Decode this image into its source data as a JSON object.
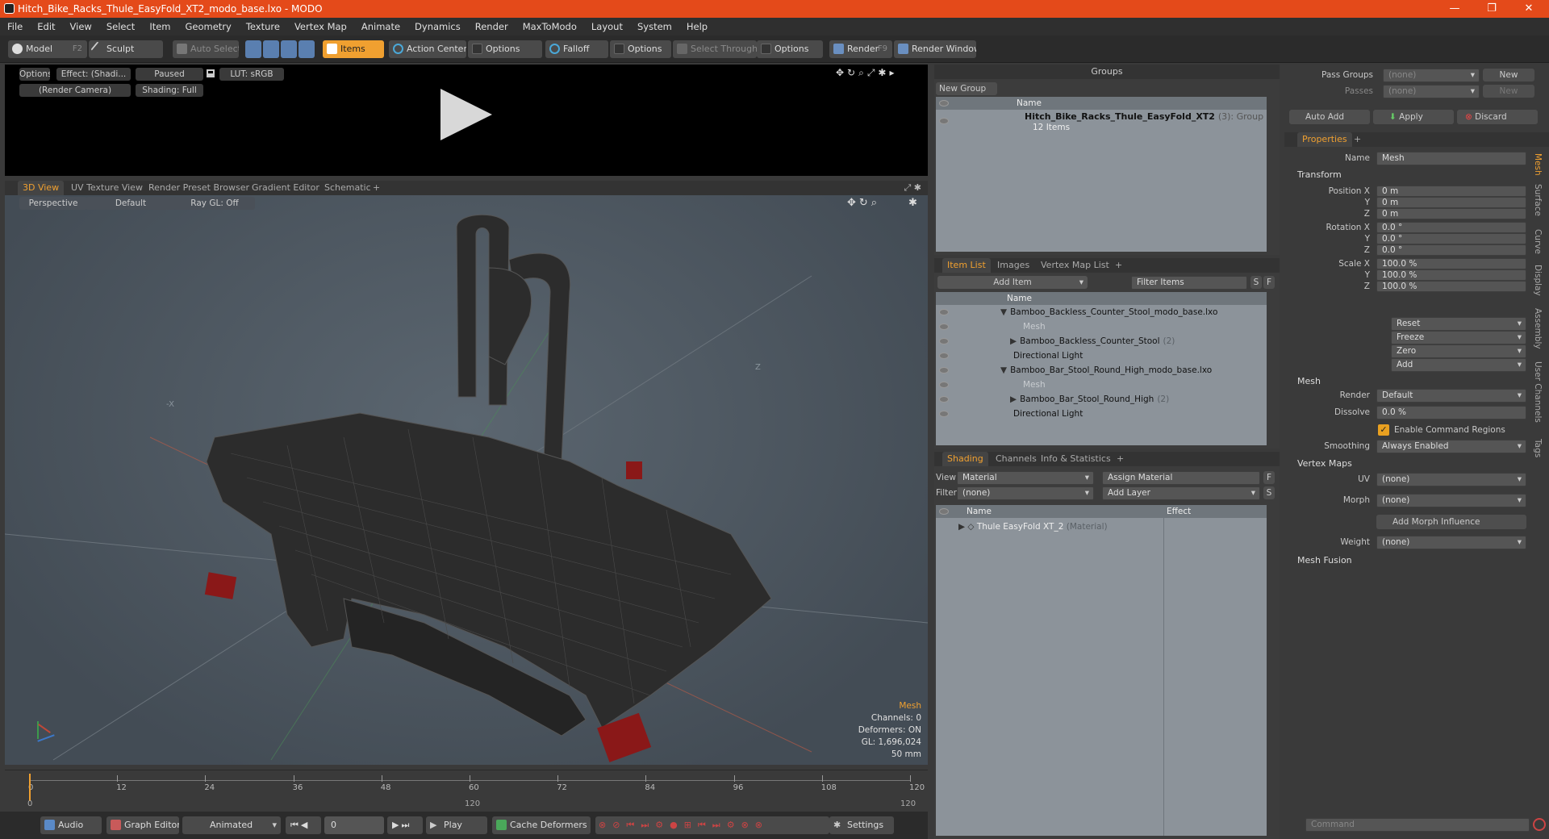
{
  "window": {
    "title": "Hitch_Bike_Racks_Thule_EasyFold_XT2_modo_base.lxo - MODO",
    "min": "—",
    "max": "❐",
    "close": "✕"
  },
  "menu": [
    "File",
    "Edit",
    "View",
    "Select",
    "Item",
    "Geometry",
    "Texture",
    "Vertex Map",
    "Animate",
    "Dynamics",
    "Render",
    "MaxToModo",
    "Layout",
    "System",
    "Help"
  ],
  "toolbar": {
    "model": "Model",
    "model_key": "F2",
    "sculpt": "Sculpt",
    "auto_select": "Auto Select",
    "items": "Items",
    "action_center": "Action Center",
    "options1": "Options",
    "falloff": "Falloff",
    "options2": "Options",
    "select_through": "Select Through",
    "options3": "Options",
    "render": "Render",
    "render_key": "F9",
    "render_window": "Render Window"
  },
  "preview": {
    "options": "Options",
    "effect": "Effect: (Shadi...",
    "paused": "Paused",
    "lut": "LUT: sRGB",
    "camera": "(Render Camera)",
    "shading": "Shading: Full"
  },
  "viewport_tabs": [
    "3D View",
    "UV Texture View",
    "Render Preset Browser",
    "Gradient Editor",
    "Schematic",
    "+"
  ],
  "viewport": {
    "perspective": "Perspective",
    "default": "Default",
    "raygl": "Ray GL: Off",
    "axis_z": "Z",
    "axis_x": "-X",
    "info": {
      "mesh": "Mesh",
      "channels": "Channels: 0",
      "deformers": "Deformers: ON",
      "gl": "GL: 1,696,024",
      "mm": "50 mm"
    }
  },
  "timeline": {
    "ticks": [
      "0",
      "12",
      "24",
      "36",
      "48",
      "60",
      "72",
      "84",
      "96",
      "108",
      "120"
    ],
    "sub_ticks": [
      "0",
      "120",
      "120"
    ]
  },
  "bottombar": {
    "audio": "Audio",
    "graph_editor": "Graph Editor",
    "animated": "Animated",
    "frame": "0",
    "play": "Play",
    "cache": "Cache Deformers",
    "settings": "Settings"
  },
  "groups": {
    "title": "Groups",
    "new_group": "New Group",
    "col_name": "Name",
    "item_name": "Hitch_Bike_Racks_Thule_EasyFold_XT2",
    "item_count": "(3)",
    "item_type": ": Group",
    "item_sub": "12 Items"
  },
  "itemlist": {
    "tabs": [
      "Item List",
      "Images",
      "Vertex Map List",
      "+"
    ],
    "add_item": "Add Item",
    "filter": "Filter Items",
    "s": "S",
    "f": "F",
    "col_name": "Name",
    "rows": [
      {
        "name": "Bamboo_Backless_Counter_Stool_modo_base.lxo",
        "indent": 0,
        "arrow": "▼",
        "extra": ""
      },
      {
        "name": "Mesh",
        "indent": 2,
        "arrow": "",
        "extra": "",
        "dim": true
      },
      {
        "name": "Bamboo_Backless_Counter_Stool",
        "indent": 1,
        "arrow": "▶",
        "extra": "(2)"
      },
      {
        "name": "Directional Light",
        "indent": 1,
        "arrow": "",
        "extra": ""
      },
      {
        "name": "Bamboo_Bar_Stool_Round_High_modo_base.lxo",
        "indent": 0,
        "arrow": "▼",
        "extra": ""
      },
      {
        "name": "Mesh",
        "indent": 2,
        "arrow": "",
        "extra": "",
        "dim": true
      },
      {
        "name": "Bamboo_Bar_Stool_Round_High",
        "indent": 1,
        "arrow": "▶",
        "extra": "(2)"
      },
      {
        "name": "Directional Light",
        "indent": 1,
        "arrow": "",
        "extra": ""
      }
    ]
  },
  "shading": {
    "tabs": [
      "Shading",
      "Channels",
      "Info & Statistics",
      "+"
    ],
    "view_lbl": "View",
    "view": "Material",
    "assign": "Assign Material",
    "filter_lbl": "Filter",
    "filter": "(none)",
    "add_layer": "Add Layer",
    "f": "F",
    "s": "S",
    "col_name": "Name",
    "col_effect": "Effect",
    "row_name": "Thule EasyFold XT_2",
    "row_type": "(Material)"
  },
  "passes": {
    "pass_groups": "Pass Groups",
    "pass_val": "(none)",
    "new": "New",
    "passes": "Passes",
    "passes_val": "(none)",
    "new2": "New",
    "auto_add": "Auto Add",
    "apply": "Apply",
    "discard": "Discard"
  },
  "properties": {
    "tab": "Properties",
    "plus": "+",
    "name_lbl": "Name",
    "name": "Mesh",
    "transform": "Transform",
    "pos": [
      {
        "l": "Position X",
        "v": "0 m"
      },
      {
        "l": "Y",
        "v": "0 m"
      },
      {
        "l": "Z",
        "v": "0 m"
      }
    ],
    "rot": [
      {
        "l": "Rotation X",
        "v": "0.0 °"
      },
      {
        "l": "Y",
        "v": "0.0 °"
      },
      {
        "l": "Z",
        "v": "0.0 °"
      }
    ],
    "scl": [
      {
        "l": "Scale X",
        "v": "100.0 %"
      },
      {
        "l": "Y",
        "v": "100.0 %"
      },
      {
        "l": "Z",
        "v": "100.0 %"
      }
    ],
    "actions": [
      "Reset",
      "Freeze",
      "Zero",
      "Add"
    ],
    "mesh": "Mesh",
    "render_lbl": "Render",
    "render": "Default",
    "dissolve_lbl": "Dissolve",
    "dissolve": "0.0 %",
    "enable_cmd": "Enable Command Regions",
    "smoothing_lbl": "Smoothing",
    "smoothing": "Always Enabled",
    "vertex_maps": "Vertex Maps",
    "uv_lbl": "UV",
    "uv": "(none)",
    "morph_lbl": "Morph",
    "morph": "(none)",
    "add_morph": "Add Morph Influence",
    "weight_lbl": "Weight",
    "weight": "(none)",
    "mesh_fusion": "Mesh Fusion",
    "side_tabs": [
      "Mesh",
      "Surface",
      "Curve",
      "Display",
      "Assembly",
      "User Channels",
      "Tags"
    ]
  },
  "command": {
    "placeholder": "Command"
  },
  "colors": {
    "accent": "#f0a030",
    "title": "#e44a1a"
  }
}
